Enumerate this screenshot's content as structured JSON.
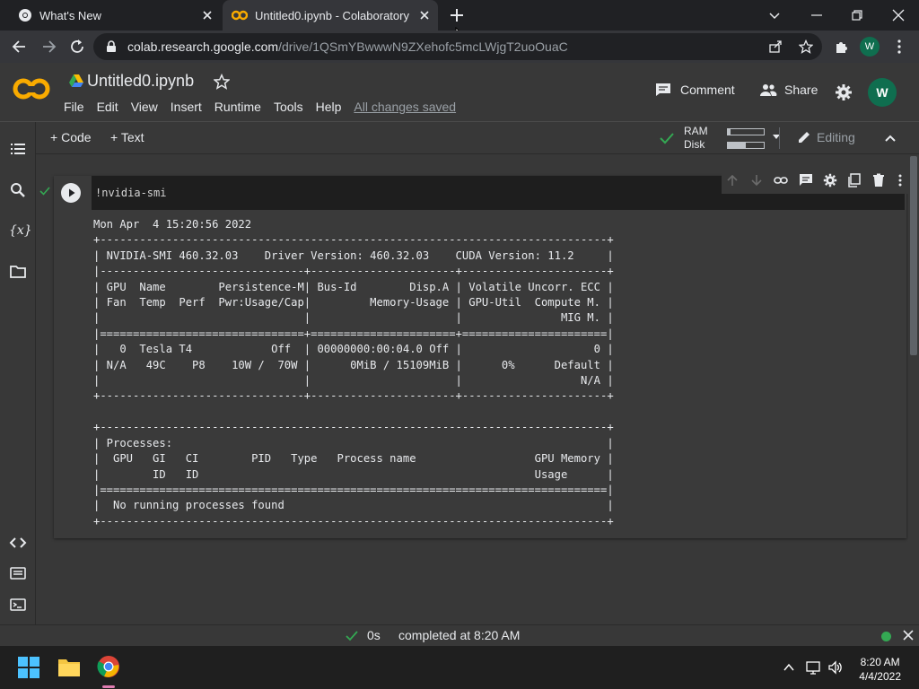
{
  "browser": {
    "tabs": [
      {
        "title": "What's New"
      },
      {
        "title": "Untitled0.ipynb - Colaboratory"
      }
    ],
    "url_host": "colab.research.google.com",
    "url_path": "/drive/1QSmYBwwwN9ZXehofc5mcLWjgT2uoOuaC",
    "profile_initial": "W"
  },
  "colab": {
    "logo": "CO",
    "notebook_title": "Untitled0.ipynb",
    "menu": [
      "File",
      "Edit",
      "View",
      "Insert",
      "Runtime",
      "Tools",
      "Help"
    ],
    "save_status": "All changes saved",
    "comment_label": "Comment",
    "share_label": "Share",
    "user_initial": "W",
    "add_code_label": "Code",
    "add_text_label": "Text",
    "ram_label": "RAM",
    "disk_label": "Disk",
    "ram_usage": 0.08,
    "disk_usage": 0.5,
    "editing_label": "Editing"
  },
  "cell": {
    "code": "!nvidia-smi",
    "output": "Mon Apr  4 15:20:56 2022       \n+-----------------------------------------------------------------------------+\n| NVIDIA-SMI 460.32.03    Driver Version: 460.32.03    CUDA Version: 11.2     |\n|-------------------------------+----------------------+----------------------+\n| GPU  Name        Persistence-M| Bus-Id        Disp.A | Volatile Uncorr. ECC |\n| Fan  Temp  Perf  Pwr:Usage/Cap|         Memory-Usage | GPU-Util  Compute M. |\n|                               |                      |               MIG M. |\n|===============================+======================+======================|\n|   0  Tesla T4            Off  | 00000000:00:04.0 Off |                    0 |\n| N/A   49C    P8    10W /  70W |      0MiB / 15109MiB |      0%      Default |\n|                               |                      |                  N/A |\n+-------------------------------+----------------------+----------------------+\n                                                                               \n+-----------------------------------------------------------------------------+\n| Processes:                                                                  |\n|  GPU   GI   CI        PID   Type   Process name                  GPU Memory |\n|        ID   ID                                                   Usage      |\n|=============================================================================|\n|  No running processes found                                                 |\n+-----------------------------------------------------------------------------+"
  },
  "status": {
    "duration": "0s",
    "message": "completed at 8:20 AM"
  },
  "taskbar": {
    "time": "8:20 AM",
    "date": "4/4/2022"
  },
  "colors": {
    "accent_orange": "#f9ab00",
    "check_green": "#34a853",
    "avatar_green": "#0f6e4f"
  }
}
